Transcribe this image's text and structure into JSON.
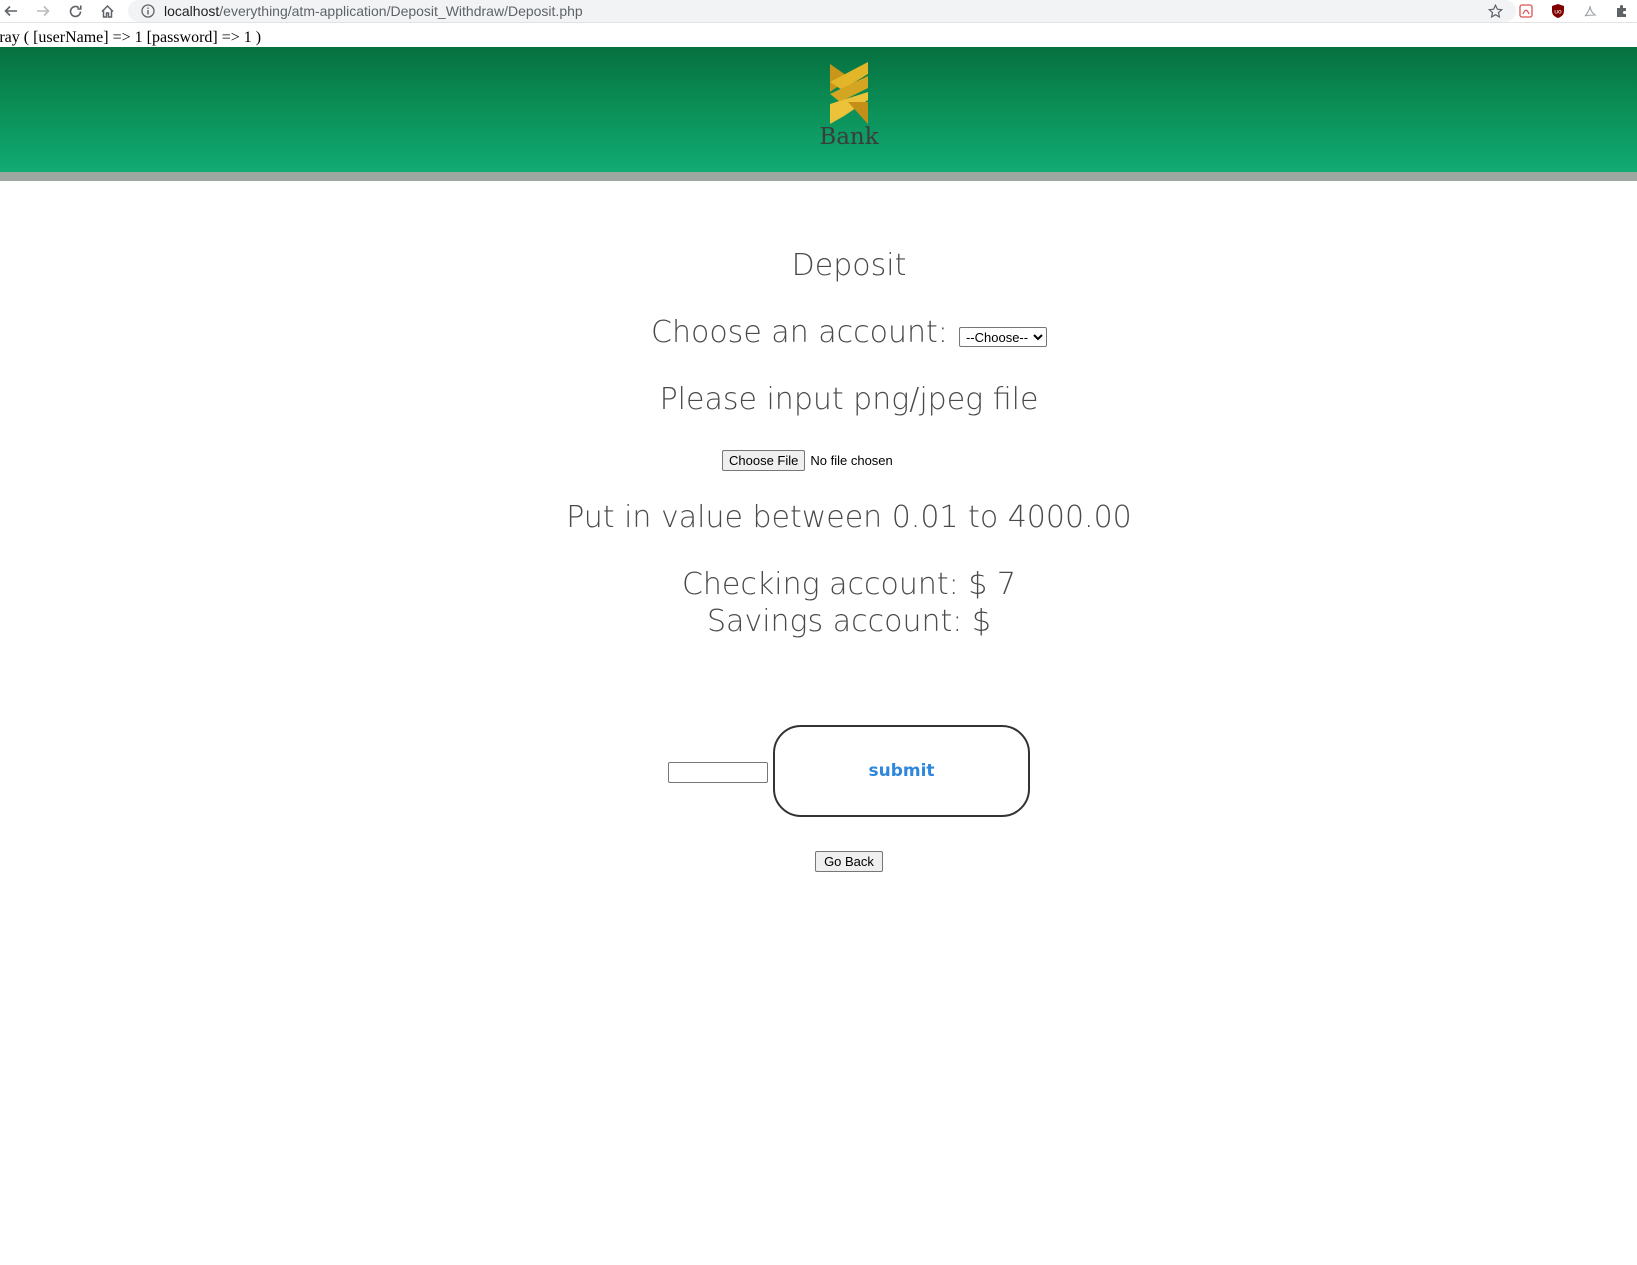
{
  "browser": {
    "url_host": "localhost",
    "url_path": "/everything/atm-application/Deposit_Withdraw/Deposit.php",
    "icons": [
      "back-icon",
      "forward-icon",
      "reload-icon",
      "home-icon",
      "info-icon",
      "star-icon",
      "pdf-extension-icon",
      "ublock-extension-icon",
      "acrobat-extension-icon",
      "puzzle-extension-icon"
    ]
  },
  "debug": {
    "text": "rray ( [userName] => 1 [password] => 1 )"
  },
  "header": {
    "logo_text": "Bank",
    "colors": {
      "banner_top": "#06703f",
      "banner_bottom": "#10ab73",
      "stripe": "#9ea6a1",
      "logo_gold": "#e0b020"
    }
  },
  "main": {
    "title": "Deposit",
    "account_label": "Choose an account:",
    "account_select_value": "--Choose--",
    "file_prompt": "Please input png/jpeg file",
    "choose_file_label": "Choose File",
    "file_status": "No file chosen",
    "range_text": "Put in value between 0.01 to 4000.00",
    "checking_text": "Checking account: $ 7",
    "savings_text": "Savings account: $",
    "amount_value": "",
    "submit_label": "submit",
    "go_back_label": "Go Back",
    "colors": {
      "submit_text": "#2f86dd",
      "heading_text": "#4a4a4a"
    }
  }
}
